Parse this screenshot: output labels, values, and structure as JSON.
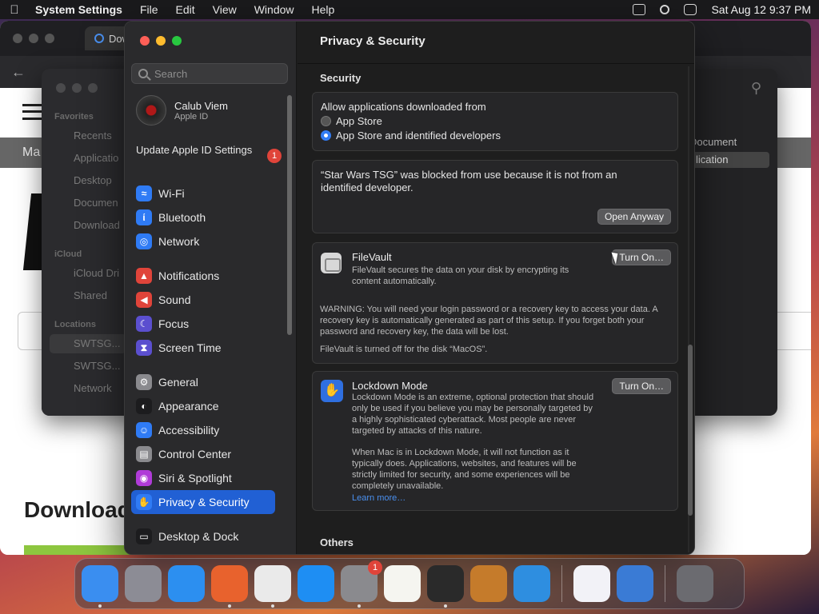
{
  "menubar": {
    "app_name": "System Settings",
    "items": [
      "File",
      "Edit",
      "View",
      "Window",
      "Help"
    ],
    "datetime": "Sat Aug 12  9:37 PM"
  },
  "browser": {
    "tab_label": "Dow",
    "strip_text": "Ma",
    "big_title": "Download"
  },
  "finder": {
    "favorites_label": "Favorites",
    "favorites": [
      "Recents",
      "Applicatio",
      "Desktop",
      "Documen",
      "Download"
    ],
    "icloud_label": "iCloud",
    "icloud": [
      "iCloud Dri",
      "Shared"
    ],
    "locations_label": "Locations",
    "locations": [
      "SWTSG...",
      "SWTSG...",
      "Network"
    ],
    "right_header": "Document",
    "right_selected": "lication"
  },
  "settings": {
    "title": "Privacy & Security",
    "search_placeholder": "Search",
    "profile": {
      "name": "Calub Viem",
      "subtitle": "Apple ID"
    },
    "update": {
      "label": "Update Apple ID Settings",
      "badge": "1"
    },
    "sidebar_groups": [
      [
        {
          "label": "Wi-Fi",
          "icon": "wifi",
          "color": "#2f7bf5"
        },
        {
          "label": "Bluetooth",
          "icon": "bluetooth",
          "color": "#2f7bf5"
        },
        {
          "label": "Network",
          "icon": "globe",
          "color": "#2f7bf5"
        }
      ],
      [
        {
          "label": "Notifications",
          "icon": "bell",
          "color": "#e0443a"
        },
        {
          "label": "Sound",
          "icon": "speaker",
          "color": "#e0443a"
        },
        {
          "label": "Focus",
          "icon": "moon",
          "color": "#5b4fcf"
        },
        {
          "label": "Screen Time",
          "icon": "hourglass",
          "color": "#5b4fcf"
        }
      ],
      [
        {
          "label": "General",
          "icon": "gear",
          "color": "#8a8a8e"
        },
        {
          "label": "Appearance",
          "icon": "appearance",
          "color": "#1c1c1e"
        },
        {
          "label": "Accessibility",
          "icon": "accessibility",
          "color": "#2f7bf5"
        },
        {
          "label": "Control Center",
          "icon": "control-center",
          "color": "#8a8a8e"
        },
        {
          "label": "Siri & Spotlight",
          "icon": "siri",
          "color": "#b03bd8"
        },
        {
          "label": "Privacy & Security",
          "icon": "hand",
          "color": "#2f7bf5",
          "active": true
        }
      ],
      [
        {
          "label": "Desktop & Dock",
          "icon": "dock",
          "color": "#1c1c1e"
        }
      ]
    ],
    "security": {
      "section_title": "Security",
      "allow_label": "Allow applications downloaded from",
      "options": [
        {
          "label": "App Store",
          "selected": false
        },
        {
          "label": "App Store and identified developers",
          "selected": true
        }
      ],
      "blocked_message": "“Star Wars TSG” was blocked from use because it is not from an identified developer.",
      "open_anyway": "Open Anyway"
    },
    "filevault": {
      "title": "FileVault",
      "description": "FileVault secures the data on your disk by encrypting its content automatically.",
      "button": "Turn On…",
      "warning": "WARNING: You will need your login password or a recovery key to access your data. A recovery key is automatically generated as part of this setup. If you forget both your password and recovery key, the data will be lost.",
      "status": "FileVault is turned off for the disk “MacOS”."
    },
    "lockdown": {
      "title": "Lockdown Mode",
      "description": "Lockdown Mode is an extreme, optional protection that should only be used if you believe you may be personally targeted by a highly sophisticated cyberattack. Most people are never targeted by attacks of this nature.",
      "detail": "When Mac is in Lockdown Mode, it will not function as it typically does. Applications, websites, and features will be strictly limited for security, and some experiences will be completely unavailable.",
      "learn_more": "Learn more…",
      "button": "Turn On…"
    },
    "others_title": "Others"
  },
  "dock": {
    "apps": [
      {
        "name": "Finder",
        "color": "#3a8ef0",
        "running": true
      },
      {
        "name": "Launchpad",
        "color": "#8c8c95",
        "running": false
      },
      {
        "name": "Safari",
        "color": "#2c8ff0",
        "running": false
      },
      {
        "name": "Firefox",
        "color": "#e8622d",
        "running": true
      },
      {
        "name": "Chrome",
        "color": "#eaeaea",
        "running": true
      },
      {
        "name": "App Store",
        "color": "#1e8ef3",
        "running": false
      },
      {
        "name": "System Settings",
        "color": "#8a8a8e",
        "running": true,
        "badge": "1"
      },
      {
        "name": "TextEdit",
        "color": "#f5f5f0",
        "running": false
      },
      {
        "name": "Terminal",
        "color": "#2a2a2a",
        "running": true
      },
      {
        "name": "GarageBand",
        "color": "#c57b2b",
        "running": false
      },
      {
        "name": "VS Code",
        "color": "#2e8ee0",
        "running": false
      },
      {
        "name": "Visual Studio",
        "color": "#f2f2f7",
        "running": false
      },
      {
        "name": "Weather",
        "color": "#3a7bd5",
        "running": false
      },
      {
        "name": "Trash",
        "color": "#6b6b70",
        "running": false
      }
    ]
  }
}
